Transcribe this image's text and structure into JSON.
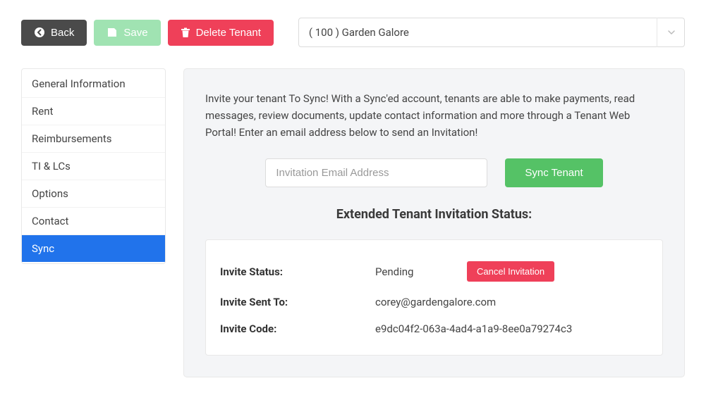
{
  "topbar": {
    "back_label": "Back",
    "save_label": "Save",
    "delete_label": "Delete Tenant"
  },
  "tenant_select": {
    "selected": "( 100 ) Garden Galore"
  },
  "sidebar": {
    "items": [
      {
        "label": "General Information",
        "active": false
      },
      {
        "label": "Rent",
        "active": false
      },
      {
        "label": "Reimbursements",
        "active": false
      },
      {
        "label": "TI & LCs",
        "active": false
      },
      {
        "label": "Options",
        "active": false
      },
      {
        "label": "Contact",
        "active": false
      },
      {
        "label": "Sync",
        "active": true
      }
    ]
  },
  "main": {
    "intro": "Invite your tenant To Sync! With a Sync'ed account, tenants are able to make payments, read messages, review documents, update contact information and more through a Tenant Web Portal! Enter an email address below to send an Invitation!",
    "email_placeholder": "Invitation Email Address",
    "sync_button": "Sync Tenant",
    "status_heading": "Extended Tenant Invitation Status:",
    "cancel_label": "Cancel Invitation",
    "rows": {
      "status": {
        "label": "Invite Status:",
        "value": "Pending"
      },
      "sent_to": {
        "label": "Invite Sent To:",
        "value": "corey@gardengalore.com"
      },
      "code": {
        "label": "Invite Code:",
        "value": "e9dc04f2-063a-4ad4-a1a9-8ee0a79274c3"
      }
    }
  }
}
